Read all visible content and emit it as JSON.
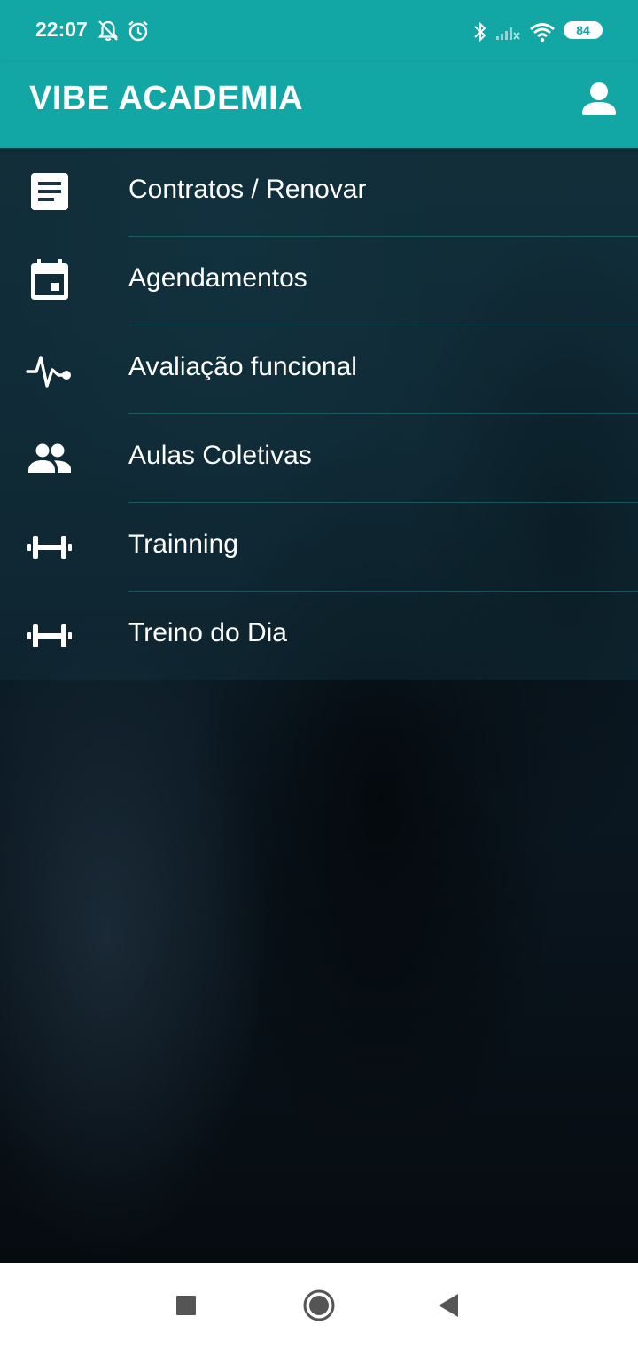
{
  "status_bar": {
    "time": "22:07",
    "battery": "84",
    "icons": [
      "bell-off-icon",
      "alarm-icon",
      "bluetooth-icon",
      "signal-icon",
      "wifi-icon",
      "battery-icon"
    ]
  },
  "app_bar": {
    "title": "VIBE ACADEMIA",
    "profile_icon": "account-icon"
  },
  "menu": {
    "items": [
      {
        "label": "Contratos / Renovar",
        "icon": "document-icon"
      },
      {
        "label": "Agendamentos",
        "icon": "calendar-icon"
      },
      {
        "label": "Avaliação funcional",
        "icon": "heartbeat-icon"
      },
      {
        "label": "Aulas Coletivas",
        "icon": "group-icon"
      },
      {
        "label": "Trainning",
        "icon": "dumbbell-icon"
      },
      {
        "label": "Treino do Dia",
        "icon": "dumbbell-icon"
      }
    ]
  },
  "nav_bar": {
    "icons": [
      "recents-square-icon",
      "home-circle-icon",
      "back-triangle-icon"
    ]
  },
  "colors": {
    "accent": "#12a6a4",
    "text": "#ffffff",
    "nav_bar": "#ffffff"
  }
}
